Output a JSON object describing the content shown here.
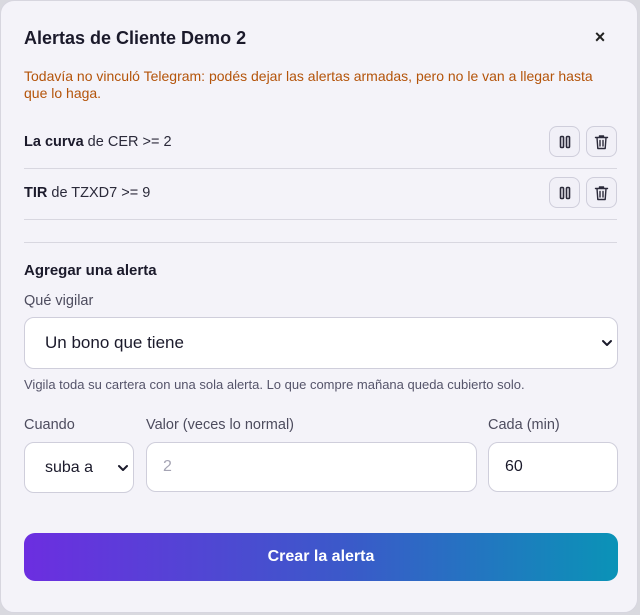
{
  "dialog": {
    "title": "Alertas de Cliente Demo 2",
    "close_label": "×",
    "warning": "Todavía no vinculó Telegram: podés dejar las alertas armadas, pero no le van a llegar hasta que lo haga."
  },
  "alerts": [
    {
      "metric": "La curva",
      "text": " de CER >= 2"
    },
    {
      "metric": "TIR",
      "text": " de TZXD7 >= 9"
    }
  ],
  "form": {
    "section_title": "Agregar una alerta",
    "watch_label": "Qué vigilar",
    "watch_value": "Un bono que tiene",
    "hint": "Vigila toda su cartera con una sola alerta. Lo que compre mañana queda cubierto solo.",
    "when_label": "Cuando",
    "when_value": "suba a",
    "value_label": "Valor (veces lo normal)",
    "value_placeholder": "2",
    "every_label": "Cada (min)",
    "every_value": "60",
    "submit_label": "Crear la alerta"
  },
  "colors": {
    "warning": "#b4540a",
    "gradient_start": "#6c2ee0",
    "gradient_end": "#0a93b7"
  },
  "icons": [
    "close-icon",
    "pause-icon",
    "trash-icon",
    "chevron-down-icon"
  ]
}
